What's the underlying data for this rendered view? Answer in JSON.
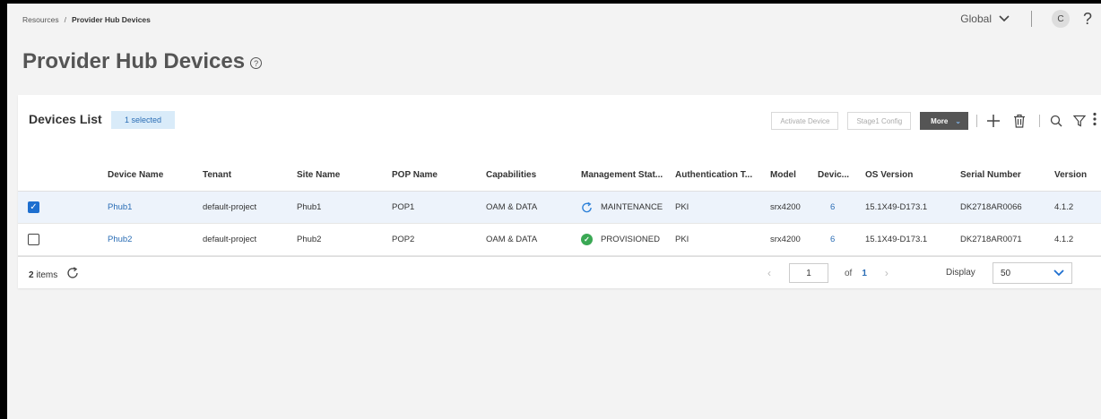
{
  "breadcrumb": {
    "root": "Resources",
    "separator": "/",
    "current": "Provider Hub Devices"
  },
  "topbar": {
    "scope": "Global",
    "avatar_initial": "C",
    "help": "?"
  },
  "page": {
    "title": "Provider Hub Devices"
  },
  "card": {
    "title": "Devices List",
    "selected_badge": "1 selected",
    "toolbar": {
      "activate": "Activate Device",
      "stage1": "Stage1 Config",
      "more": "More"
    }
  },
  "table": {
    "columns": [
      "Device Name",
      "Tenant",
      "Site Name",
      "POP Name",
      "Capabilities",
      "Management Stat...",
      "Authentication T...",
      "Model",
      "Devic...",
      "OS Version",
      "Serial Number",
      "Version"
    ],
    "rows": [
      {
        "selected": true,
        "device": "Phub1",
        "tenant": "default-project",
        "site": "Phub1",
        "pop": "POP1",
        "capabilities": "OAM & DATA",
        "status": "MAINTENANCE",
        "status_icon": "refresh-icon",
        "auth": "PKI",
        "model": "srx4200",
        "devices": "6",
        "os": "15.1X49-D173.1",
        "serial": "DK2718AR0066",
        "version": "4.1.2"
      },
      {
        "selected": false,
        "device": "Phub2",
        "tenant": "default-project",
        "site": "Phub2",
        "pop": "POP2",
        "capabilities": "OAM & DATA",
        "status": "PROVISIONED",
        "status_icon": "check-circle-icon",
        "auth": "PKI",
        "model": "srx4200",
        "devices": "6",
        "os": "15.1X49-D173.1",
        "serial": "DK2718AR0071",
        "version": "4.1.2"
      }
    ]
  },
  "footer": {
    "count": "2",
    "count_label": "items",
    "page": "1",
    "of": "of",
    "total_pages": "1",
    "display_label": "Display",
    "page_size": "50"
  },
  "colors": {
    "accent": "#1e6fcf",
    "link": "#2a6db5",
    "ok": "#3aa854",
    "badge_bg": "#d9ebf9"
  }
}
